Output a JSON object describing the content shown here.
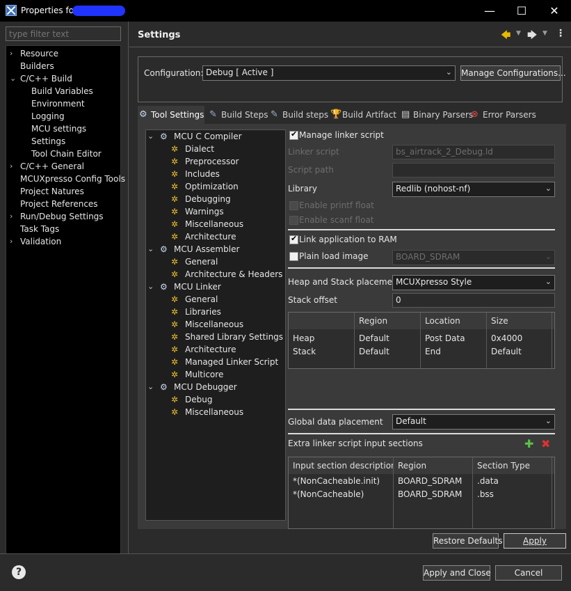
{
  "window": {
    "title": "Properties for ",
    "minimize_glyph": "—",
    "maximize_glyph": "☐",
    "close_glyph": "✕"
  },
  "filter": {
    "placeholder": "type filter text"
  },
  "nav": [
    {
      "label": "Resource",
      "expand": "›"
    },
    {
      "label": "Builders",
      "expand": ""
    },
    {
      "label": "C/C++ Build",
      "expand": "⌄"
    },
    {
      "label": "Build Variables",
      "expand": ""
    },
    {
      "label": "Environment",
      "expand": ""
    },
    {
      "label": "Logging",
      "expand": ""
    },
    {
      "label": "MCU settings",
      "expand": ""
    },
    {
      "label": "Settings",
      "expand": ""
    },
    {
      "label": "Tool Chain Editor",
      "expand": ""
    },
    {
      "label": "C/C++ General",
      "expand": "›"
    },
    {
      "label": "MCUXpresso Config Tools",
      "expand": ""
    },
    {
      "label": "Project Natures",
      "expand": ""
    },
    {
      "label": "Project References",
      "expand": ""
    },
    {
      "label": "Run/Debug Settings",
      "expand": "›"
    },
    {
      "label": "Task Tags",
      "expand": ""
    },
    {
      "label": "Validation",
      "expand": "›"
    }
  ],
  "settings": {
    "title": "Settings",
    "configuration_label": "Configuration:",
    "configuration_value": "Debug  [ Active ]",
    "manage_button": "Manage Configurations..."
  },
  "tabs": [
    {
      "label": "Tool Settings",
      "icon": "tool-settings-icon"
    },
    {
      "label": "Build Steps",
      "icon": "build-steps-icon"
    },
    {
      "label": "Build steps",
      "icon": "build-steps-icon"
    },
    {
      "label": "Build Artifact",
      "icon": "trophy-icon"
    },
    {
      "label": "Binary Parsers",
      "icon": "binary-parsers-icon"
    },
    {
      "label": "Error Parsers",
      "icon": "error-parsers-icon"
    }
  ],
  "tool_tree": [
    {
      "label": "MCU C Compiler",
      "level": 0
    },
    {
      "label": "Dialect",
      "level": 1
    },
    {
      "label": "Preprocessor",
      "level": 1
    },
    {
      "label": "Includes",
      "level": 1
    },
    {
      "label": "Optimization",
      "level": 1
    },
    {
      "label": "Debugging",
      "level": 1
    },
    {
      "label": "Warnings",
      "level": 1
    },
    {
      "label": "Miscellaneous",
      "level": 1
    },
    {
      "label": "Architecture",
      "level": 1
    },
    {
      "label": "MCU Assembler",
      "level": 0
    },
    {
      "label": "General",
      "level": 1
    },
    {
      "label": "Architecture & Headers",
      "level": 1
    },
    {
      "label": "MCU Linker",
      "level": 0
    },
    {
      "label": "General",
      "level": 1
    },
    {
      "label": "Libraries",
      "level": 1
    },
    {
      "label": "Miscellaneous",
      "level": 1
    },
    {
      "label": "Shared Library Settings",
      "level": 1
    },
    {
      "label": "Architecture",
      "level": 1
    },
    {
      "label": "Managed Linker Script",
      "level": 1
    },
    {
      "label": "Multicore",
      "level": 1
    },
    {
      "label": "MCU Debugger",
      "level": 0
    },
    {
      "label": "Debug",
      "level": 1
    },
    {
      "label": "Miscellaneous",
      "level": 1
    }
  ],
  "linker": {
    "manage_linker_script": "Manage linker script",
    "linker_script_label": "Linker script",
    "linker_script_value": "bs_airtrack_2_Debug.ld",
    "script_path_label": "Script path",
    "script_path_value": "",
    "library_label": "Library",
    "library_value": "Redlib (nohost-nf)",
    "enable_printf": "Enable printf float",
    "enable_scanf": "Enable scanf float",
    "link_to_ram": "Link application to RAM",
    "plain_load": "Plain load image",
    "plain_load_value": "BOARD_SDRAM",
    "heap_stack_label": "Heap and Stack placement",
    "heap_stack_value": "MCUXpresso Style",
    "stack_offset_label": "Stack offset",
    "stack_offset_value": "0",
    "heap_table": {
      "headers": [
        "",
        "Region",
        "Location",
        "Size"
      ],
      "rows": [
        [
          "Heap",
          "Default",
          "Post Data",
          "0x4000"
        ],
        [
          "Stack",
          "Default",
          "End",
          "Default"
        ]
      ]
    },
    "global_data_label": "Global data placement",
    "global_data_value": "Default",
    "extra_sections_label": "Extra linker script input sections",
    "sections_table": {
      "headers": [
        "Input section description",
        "Region",
        "Section Type"
      ],
      "rows": [
        [
          "*(NonCacheable.init)",
          "BOARD_SDRAM",
          ".data"
        ],
        [
          "*(NonCacheable)",
          "BOARD_SDRAM",
          ".bss"
        ]
      ]
    }
  },
  "buttons": {
    "restore_defaults": "Restore Defaults",
    "apply": "Apply",
    "apply_and_close": "Apply and Close",
    "cancel": "Cancel"
  }
}
